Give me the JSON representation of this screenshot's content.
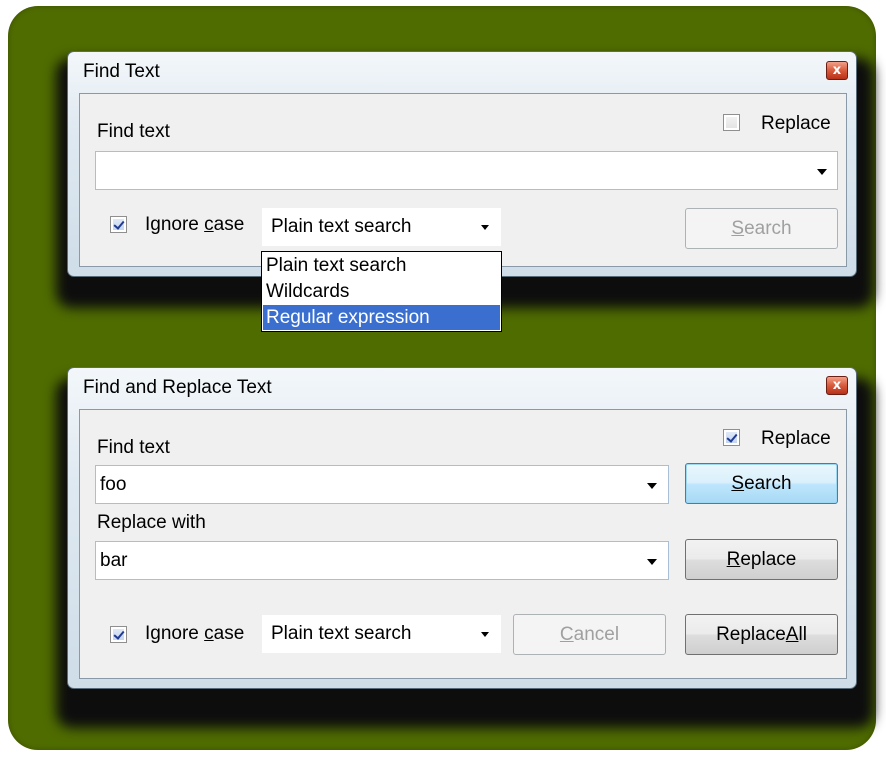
{
  "find_dialog": {
    "title": "Find Text",
    "close_symbol": "x",
    "find_label": "Find text",
    "find_value": "",
    "replace_checkbox_label": "Replace",
    "replace_checked": false,
    "ignore_case_label_pre": "Ignore ",
    "ignore_case_label_accel": "c",
    "ignore_case_label_post": "ase",
    "ignore_case_checked": true,
    "search_mode": "Plain text search",
    "search_button_accel": "S",
    "search_button_rest": "earch",
    "search_button_enabled": false,
    "search_mode_options": [
      "Plain text search",
      "Wildcards",
      "Regular expression"
    ],
    "search_mode_highlighted": "Regular expression"
  },
  "replace_dialog": {
    "title": "Find and Replace Text",
    "close_symbol": "x",
    "find_label": "Find text",
    "find_value": "foo",
    "replace_with_label": "Replace with",
    "replace_with_value": "bar",
    "replace_checkbox_label": "Replace",
    "replace_checked": true,
    "ignore_case_label_pre": "Ignore ",
    "ignore_case_label_accel": "c",
    "ignore_case_label_post": "ase",
    "ignore_case_checked": true,
    "search_mode": "Plain text search",
    "search_button_accel": "S",
    "search_button_rest": "earch",
    "replace_button_accel": "R",
    "replace_button_rest": "eplace",
    "cancel_button_accel": "C",
    "cancel_button_rest": "ancel",
    "cancel_button_enabled": false,
    "replace_all_button_pre": "Replace ",
    "replace_all_button_accel": "A",
    "replace_all_button_post": "ll"
  },
  "colors": {
    "backdrop": "#4f6c00",
    "selection": "#3a6fcf",
    "close_button": "#d85b3c"
  },
  "icons": {
    "close": "close-icon",
    "dropdown": "chevron-down-icon",
    "checkmark": "checkmark-icon"
  }
}
